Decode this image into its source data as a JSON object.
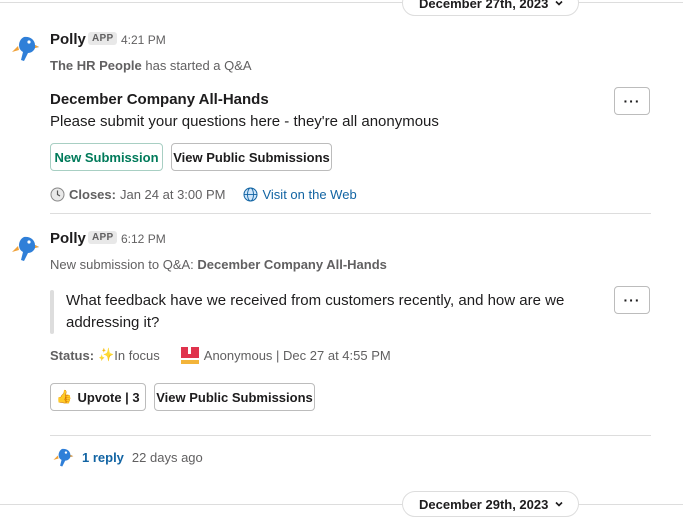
{
  "dividers": {
    "top_date": "December 27th, 2023",
    "bottom_date": "December 29th, 2023"
  },
  "message1": {
    "sender": "Polly",
    "badge": "APP",
    "time": "4:21 PM",
    "context_bold": "The HR People",
    "context_rest": " has started a Q&A",
    "title": "December Company All-Hands",
    "body": "Please submit your questions here - they're all anonymous",
    "buttons": {
      "new_submission": "New Submission",
      "view_public": "View Public Submissions"
    },
    "closes_label": "Closes:",
    "closes_value": " Jan 24 at 3:00 PM",
    "web_link": "Visit on the Web",
    "more_label": "···"
  },
  "message2": {
    "sender": "Polly",
    "badge": "APP",
    "time": "6:12 PM",
    "context_rest": "New submission to Q&A: ",
    "context_bold": "December Company All-Hands",
    "question_line1": "What feedback have we received from customers recently, and how are we",
    "question_line2": "addressing it?",
    "status_label": "Status:",
    "status_value": " In focus",
    "author_meta": "Anonymous | Dec 27 at 4:55 PM",
    "buttons": {
      "upvote": "Upvote | 3",
      "view_public": "View Public Submissions"
    },
    "more_label": "···"
  },
  "thread": {
    "reply_count": "1 reply",
    "last_reply": "22 days ago"
  },
  "colors": {
    "link": "#1264a3",
    "primary_green": "#007a5a",
    "parrot_blue": "#2f7fd8",
    "parrot_orange": "#f0a23a"
  }
}
